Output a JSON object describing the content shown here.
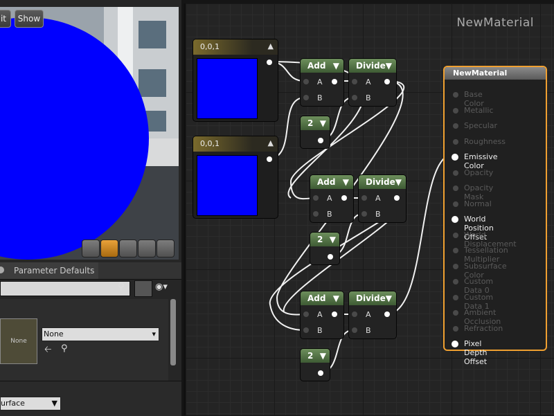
{
  "viewport": {
    "buttons": [
      {
        "label": "it"
      },
      {
        "label": "Show"
      }
    ],
    "preview_color": "#0000ff",
    "shape_buttons": [
      "cylinder-icon",
      "sphere-icon",
      "plane-icon",
      "cube-icon",
      "teapot-icon"
    ]
  },
  "details": {
    "tab_label": "Parameter Defaults",
    "texture_label": "None",
    "texture_combo": "None",
    "bottom_combo": "urface"
  },
  "graph": {
    "title": "NewMaterial",
    "constants": [
      {
        "label": "0,0,1",
        "color": "#0000ff"
      },
      {
        "label": "0,0,1",
        "color": "#0000ff"
      }
    ],
    "ops": [
      {
        "add": "Add",
        "divide": "Divide",
        "a": "A",
        "b": "B",
        "divisor": "2"
      },
      {
        "add": "Add",
        "divide": "Divide",
        "a": "A",
        "b": "B",
        "divisor": "2"
      },
      {
        "add": "Add",
        "divide": "Divide",
        "a": "A",
        "b": "B",
        "divisor": "2"
      }
    ],
    "result": {
      "title": "NewMaterial",
      "inputs": [
        {
          "label": "Base Color",
          "active": false
        },
        {
          "label": "Metallic",
          "active": false
        },
        {
          "label": "Specular",
          "active": false
        },
        {
          "label": "Roughness",
          "active": false
        },
        {
          "label": "Emissive Color",
          "active": true
        },
        {
          "label": "Opacity",
          "active": false
        },
        {
          "label": "Opacity Mask",
          "active": false
        },
        {
          "label": "Normal",
          "active": false
        },
        {
          "label": "World Position Offset",
          "active": true
        },
        {
          "label": "World Displacement",
          "active": false
        },
        {
          "label": "Tessellation Multiplier",
          "active": false
        },
        {
          "label": "Subsurface Color",
          "active": false
        },
        {
          "label": "Custom Data 0",
          "active": false
        },
        {
          "label": "Custom Data 1",
          "active": false
        },
        {
          "label": "Ambient Occlusion",
          "active": false
        },
        {
          "label": "Refraction",
          "active": false
        },
        {
          "label": "Pixel Depth Offset",
          "active": true
        }
      ]
    }
  }
}
